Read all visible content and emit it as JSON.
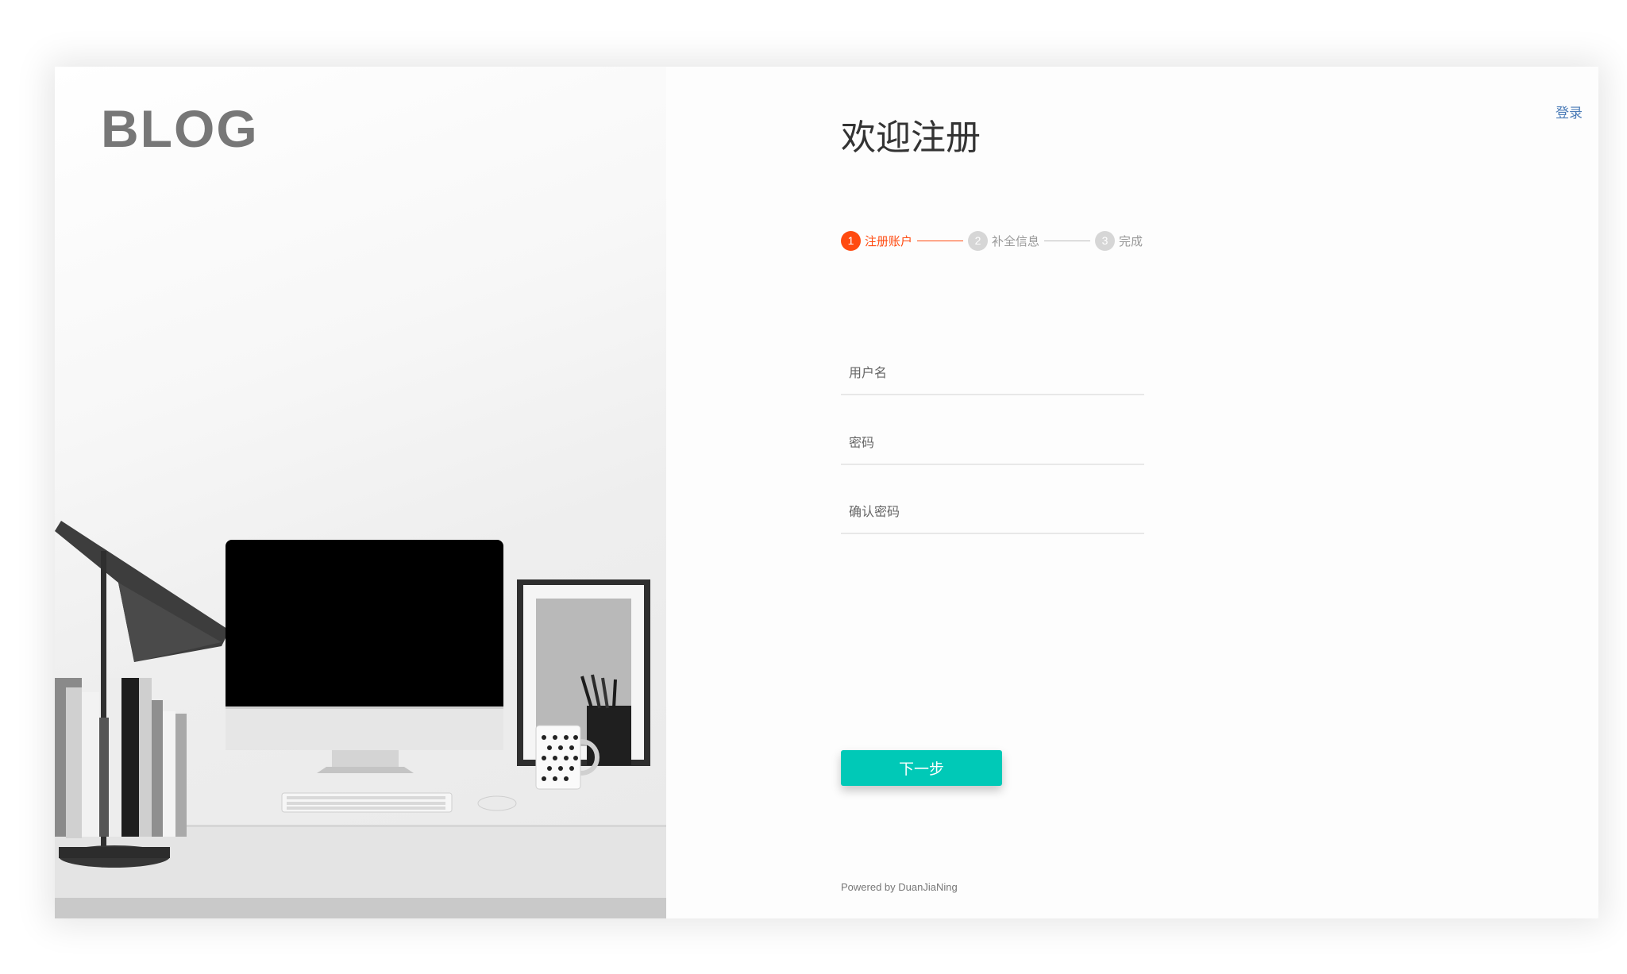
{
  "brand": {
    "logo_text": "BLOG"
  },
  "header": {
    "login_link": "登录"
  },
  "form": {
    "title": "欢迎注册",
    "steps": [
      {
        "number": "1",
        "label": "注册账户",
        "state": "active"
      },
      {
        "number": "2",
        "label": "补全信息",
        "state": "pending"
      },
      {
        "number": "3",
        "label": "完成",
        "state": "pending"
      }
    ],
    "fields": {
      "username": {
        "placeholder": "用户名",
        "value": ""
      },
      "password": {
        "placeholder": "密码",
        "value": ""
      },
      "confirm_password": {
        "placeholder": "确认密码",
        "value": ""
      }
    },
    "next_button": "下一步"
  },
  "footer": {
    "powered_by": "Powered by DuanJiaNing"
  },
  "colors": {
    "accent": "#ff4a10",
    "button": "#00c9b7",
    "link": "#4a7bb7",
    "logo": "#777777"
  },
  "illustration": {
    "icon": "desk-workspace-illustration"
  }
}
